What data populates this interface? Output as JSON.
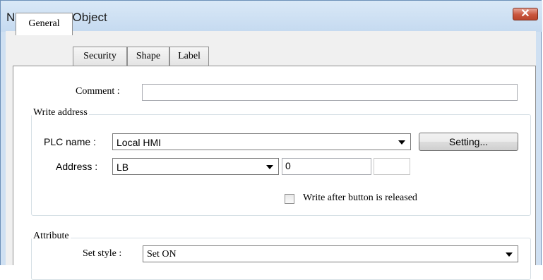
{
  "window": {
    "title": "New  Set Bit Object",
    "close_glyph": "✕"
  },
  "tabs": [
    {
      "label": "General",
      "active": true
    },
    {
      "label": "Security",
      "active": false
    },
    {
      "label": "Shape",
      "active": false
    },
    {
      "label": "Label",
      "active": false
    }
  ],
  "general": {
    "comment_label": "Comment :",
    "comment_value": "",
    "write_address": {
      "legend": "Write address",
      "plc_name_label": "PLC name :",
      "plc_name_value": "Local HMI",
      "setting_button": "Setting...",
      "address_label": "Address :",
      "address_type_value": "LB",
      "address_value": "0",
      "address_extra_value": "",
      "write_after_release_label": "Write after button is released",
      "write_after_release_checked": false
    },
    "attribute": {
      "legend": "Attribute",
      "set_style_label": "Set style :",
      "set_style_value": "Set ON"
    }
  }
}
